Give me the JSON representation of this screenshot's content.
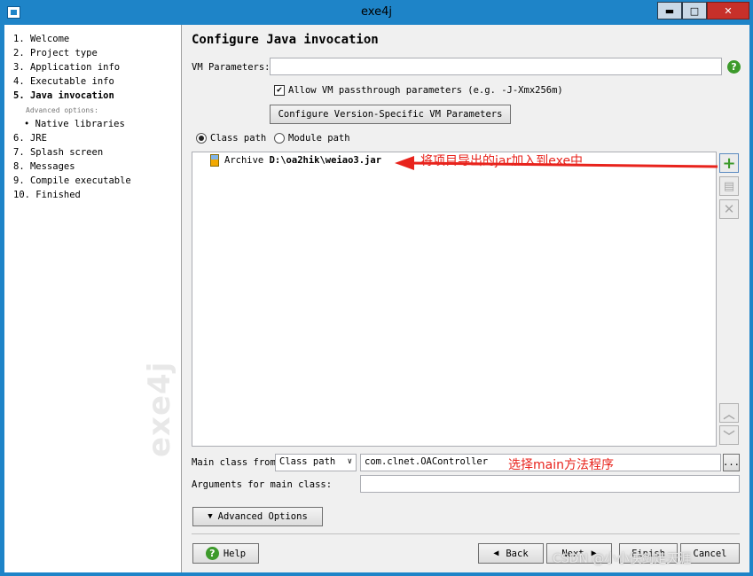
{
  "window": {
    "title": "exe4j",
    "minimize": "▬",
    "maximize": "□",
    "close": "✕"
  },
  "nav": {
    "items": [
      {
        "label": "1. Welcome"
      },
      {
        "label": "2. Project type"
      },
      {
        "label": "3. Application info"
      },
      {
        "label": "4. Executable info"
      },
      {
        "label": "5. Java invocation",
        "active": true
      },
      {
        "label": "6. JRE"
      },
      {
        "label": "7. Splash screen"
      },
      {
        "label": "8. Messages"
      },
      {
        "label": "9. Compile executable"
      },
      {
        "label": "10. Finished"
      }
    ],
    "advanced_label": "Advanced options:",
    "sub_item": "• Native libraries",
    "watermark": "exe4j"
  },
  "page": {
    "heading": "Configure Java invocation",
    "vm_params_label": "VM Parameters:",
    "vm_params_value": "",
    "help_glyph": "?",
    "allow_passthrough_label": "Allow VM passthrough parameters (e.g. -J-Xmx256m)",
    "allow_passthrough_checked": true,
    "check_glyph": "✔",
    "configure_button": "Configure Version-Specific VM Parameters",
    "class_path_radio": "Class path",
    "module_path_radio": "Module path",
    "entry_prefix": "Archive",
    "entry_path": "D:\\oa2hik\\weiao3.jar",
    "side_add": "+",
    "side_edit": "▤",
    "side_remove": "✕",
    "side_up": "︿",
    "side_down": "﹀",
    "main_class_label": "Main class from",
    "main_class_source": "Class path",
    "main_class_value": "com.clnet.OAController",
    "browse_label": "...",
    "args_label": "Arguments for main class:",
    "args_value": "",
    "advanced_button": "Advanced Options"
  },
  "footer": {
    "help": "Help",
    "back": "Back",
    "next": "Next",
    "finish": "Finish",
    "cancel": "Cancel"
  },
  "annotations": {
    "jar_note": "将项目导出的jar加入到exe中",
    "main_note": "选择main方法程序",
    "csdn": "CSDN @小小侠剑走天涯"
  },
  "colors": {
    "titlebar": "#1e84c8",
    "close": "#c7302a",
    "annotation": "#e8231c",
    "help_green": "#3d9a2b"
  }
}
